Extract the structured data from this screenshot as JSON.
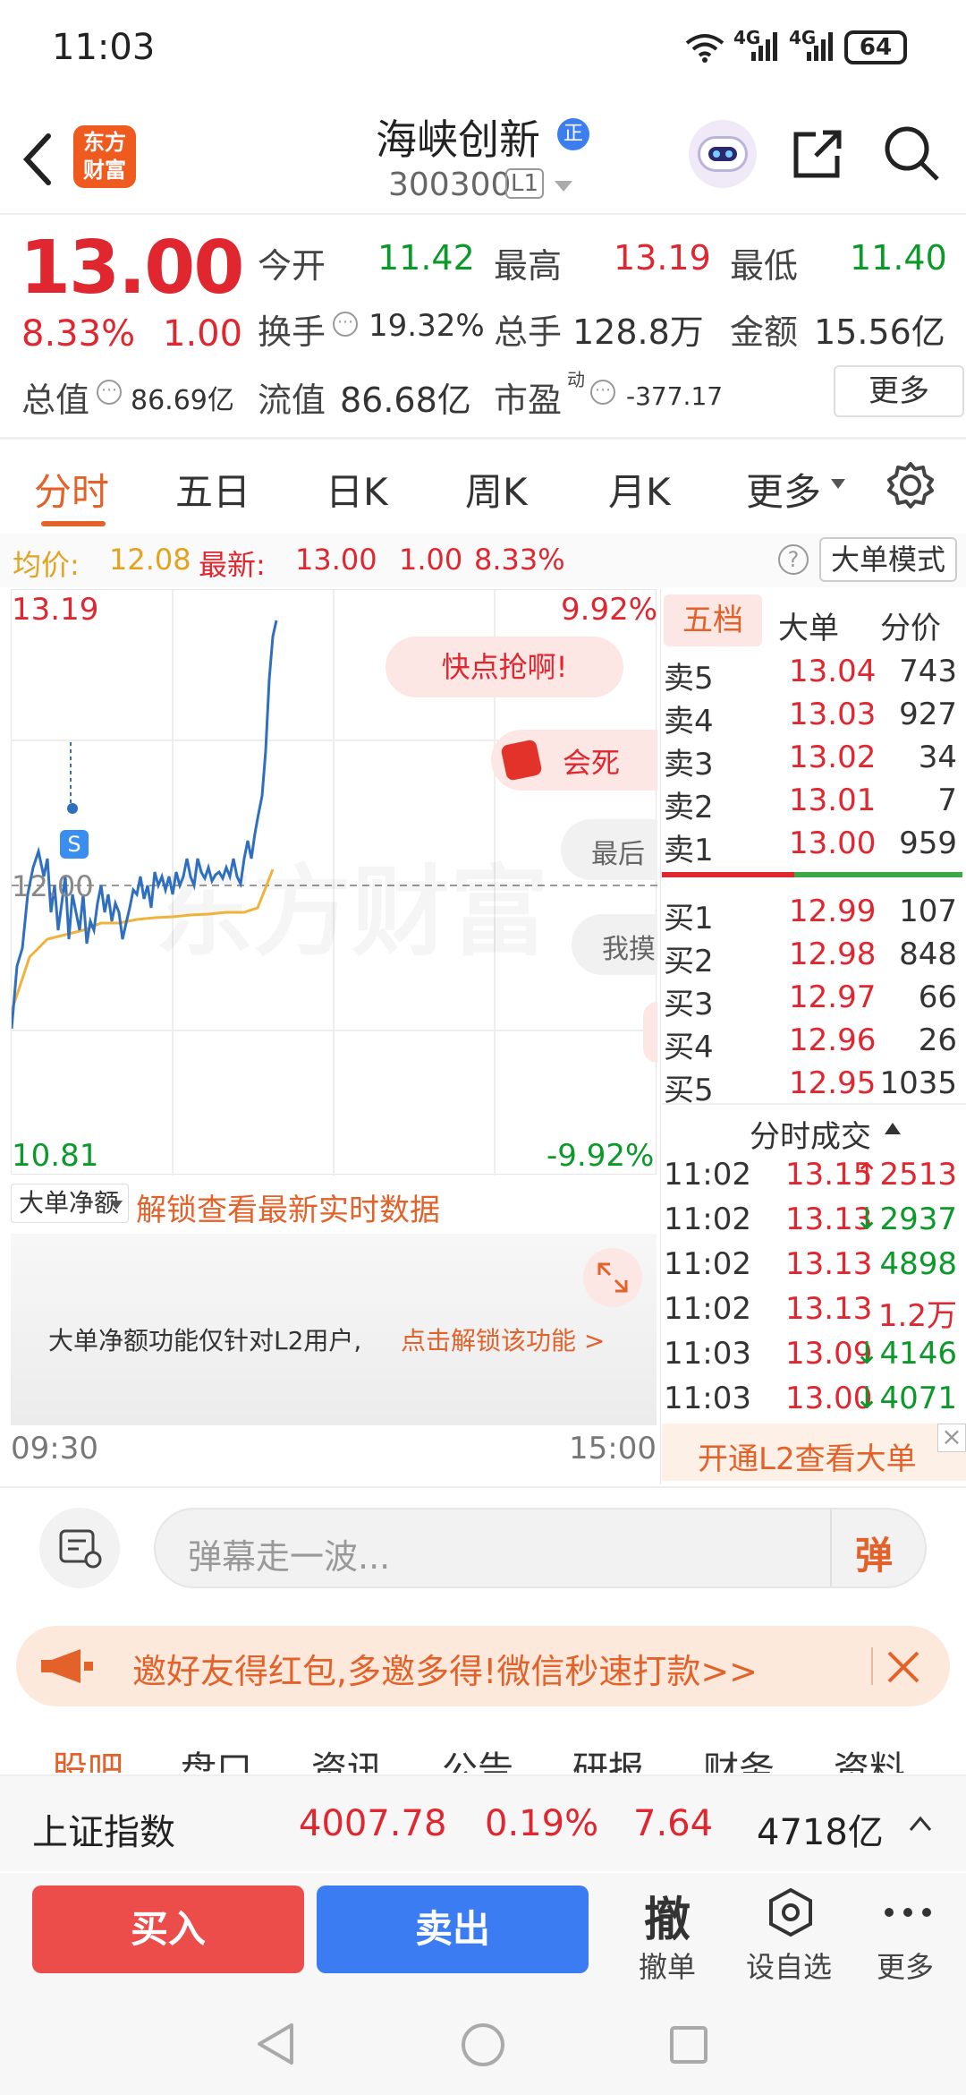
{
  "status_bar": {
    "time": "11:03",
    "signal1": "4G",
    "signal2": "4G",
    "battery": "64"
  },
  "header": {
    "back_icon": "chevron-left-icon",
    "logo_line1": "东方",
    "logo_line2": "财富",
    "stock_name": "海峡创新",
    "badge": "正",
    "stock_code": "300300",
    "level": "L1"
  },
  "quote": {
    "price": "13.00",
    "change_pct": "8.33%",
    "change_amt": "1.00",
    "open_label": "今开",
    "open": "11.42",
    "high_label": "最高",
    "high": "13.19",
    "low_label": "最低",
    "low": "11.40",
    "turnover_label": "换手",
    "turnover": "19.32%",
    "volume_label": "总手",
    "volume": "128.8万",
    "amount_label": "金额",
    "amount": "15.56亿",
    "mktcap_label": "总值",
    "mktcap": "86.69亿",
    "float_label": "流值",
    "float": "86.68亿",
    "pe_label": "市盈",
    "pe_sup": "动",
    "pe": "-377.17",
    "more": "更多"
  },
  "tabs": [
    "分时",
    "五日",
    "日K",
    "周K",
    "月K",
    "更多"
  ],
  "info_line": {
    "avg_label": "均价:",
    "avg": "12.08",
    "latest_label": "最新:",
    "latest": "13.00",
    "chg": "1.00",
    "pct": "8.33%",
    "mode_button": "大单模式"
  },
  "chart": {
    "y_top": "13.19",
    "y_mid": "12.00",
    "y_bot": "10.81",
    "pct_top": "9.92%",
    "pct_bot": "-9.92%",
    "time_start": "09:30",
    "time_end": "15:00",
    "marker": "S",
    "watermark": "东方财富"
  },
  "danmaku": [
    "快点抢啊!",
    "会死",
    "最后",
    "我摸"
  ],
  "orderbook": {
    "tabs": [
      "五档",
      "大单",
      "分价"
    ],
    "sell": [
      {
        "l": "卖5",
        "p": "13.04",
        "v": "743"
      },
      {
        "l": "卖4",
        "p": "13.03",
        "v": "927"
      },
      {
        "l": "卖3",
        "p": "13.02",
        "v": "34"
      },
      {
        "l": "卖2",
        "p": "13.01",
        "v": "7"
      },
      {
        "l": "卖1",
        "p": "13.00",
        "v": "959"
      }
    ],
    "buy": [
      {
        "l": "买1",
        "p": "12.99",
        "v": "107"
      },
      {
        "l": "买2",
        "p": "12.98",
        "v": "848"
      },
      {
        "l": "买3",
        "p": "12.97",
        "v": "66"
      },
      {
        "l": "买4",
        "p": "12.96",
        "v": "26"
      },
      {
        "l": "买5",
        "p": "12.95",
        "v": "1035"
      }
    ]
  },
  "ticks": {
    "title": "分时成交",
    "rows": [
      {
        "t": "11:02",
        "p": "13.15",
        "v": "↑2513",
        "c": "red"
      },
      {
        "t": "11:02",
        "p": "13.13",
        "v": "↓2937",
        "c": "green"
      },
      {
        "t": "11:02",
        "p": "13.13",
        "v": "4898",
        "c": "green"
      },
      {
        "t": "11:02",
        "p": "13.13",
        "v": "1.2万",
        "c": "red"
      },
      {
        "t": "11:03",
        "p": "13.09",
        "v": "↓4146",
        "c": "green"
      },
      {
        "t": "11:03",
        "p": "13.00",
        "v": "↓4071",
        "c": "green"
      }
    ],
    "l2": "开通L2查看大单"
  },
  "big_order": {
    "dropdown": "大单净额",
    "unlock": "解锁查看最新实时数据",
    "note": "大单净额功能仅针对L2用户,",
    "link": "点击解锁该功能 >"
  },
  "comment": {
    "placeholder": "弹幕走一波...",
    "send": "弹"
  },
  "promo": {
    "text": "邀好友得红包,多邀多得!微信秒速打款>>"
  },
  "bottom_tabs": [
    "股吧",
    "盘口",
    "资讯",
    "公告",
    "研报",
    "财务",
    "资料"
  ],
  "index_bar": {
    "name": "上证指数",
    "value": "4007.78",
    "pct": "0.19%",
    "chg": "7.64",
    "amount": "4718亿"
  },
  "actions": {
    "buy": "买入",
    "sell": "卖出",
    "cancel_glyph": "撤",
    "cancel": "撤单",
    "watch": "设自选",
    "more": "更多"
  },
  "colors": {
    "up": "#e0262f",
    "down": "#0b9a2a",
    "accent": "#e3622a"
  }
}
